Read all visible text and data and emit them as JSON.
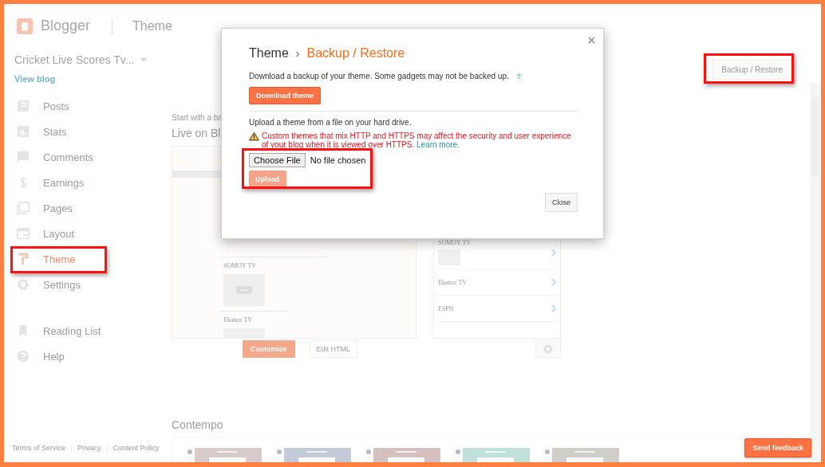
{
  "header": {
    "app_name": "Blogger",
    "page_title": "Theme"
  },
  "sidebar": {
    "blog_name": "Cricket Live Scores Tv...",
    "view_blog": "View blog",
    "items": [
      {
        "label": "Posts",
        "selected": false,
        "highlighted": false
      },
      {
        "label": "Stats",
        "selected": false,
        "highlighted": false
      },
      {
        "label": "Comments",
        "selected": false,
        "highlighted": false
      },
      {
        "label": "Earnings",
        "selected": false,
        "highlighted": false
      },
      {
        "label": "Pages",
        "selected": false,
        "highlighted": false
      },
      {
        "label": "Layout",
        "selected": false,
        "highlighted": false
      },
      {
        "label": "Theme",
        "selected": true,
        "highlighted": true
      },
      {
        "label": "Settings",
        "selected": false,
        "highlighted": false
      }
    ],
    "secondary": [
      {
        "label": "Reading List"
      },
      {
        "label": "Help"
      }
    ]
  },
  "footer_links": [
    "Terms of Service",
    "Privacy",
    "Content Policy"
  ],
  "main": {
    "backup_button": {
      "label": "Backup / Restore",
      "highlighted": true
    },
    "intro": "Start with a ba",
    "live_title": "Live on Bl",
    "live_preview": {
      "channels": [
        "SOMOY TV",
        "Ekattor TV"
      ]
    },
    "mobile_preview": {
      "channels": [
        "SOMOY TV",
        "Ekattor TV",
        "ESPN"
      ]
    },
    "customize_button": "Customize",
    "edit_html_button": "Edit HTML",
    "contempo_title": "Contempo",
    "contempo_thumbs": [
      {
        "color": "#d8cccb"
      },
      {
        "color": "#c3cbd8"
      },
      {
        "color": "#d6bfbf"
      },
      {
        "color": "#bfe0db"
      },
      {
        "color": "#cfcfc8"
      }
    ]
  },
  "dialog": {
    "breadcrumb_root": "Theme",
    "separator": "›",
    "title": "Backup / Restore",
    "close": "×",
    "download_text": "Download a backup of your theme. Some gadgets may not be backed up.",
    "help": "?",
    "download_button": "Download theme",
    "upload_text": "Upload a theme from a file on your hard drive.",
    "warning": "Custom themes that mix HTTP and HTTPS may affect the security and user experience of your blog when it is viewed over HTTPS.",
    "learn_more": "Learn more.",
    "file_picker": {
      "button": "Choose File",
      "status": "No file chosen",
      "highlighted": true
    },
    "upload_button": {
      "label": "Upload",
      "disabled": true
    },
    "close_button": "Close"
  },
  "send_feedback": "Send feedback"
}
